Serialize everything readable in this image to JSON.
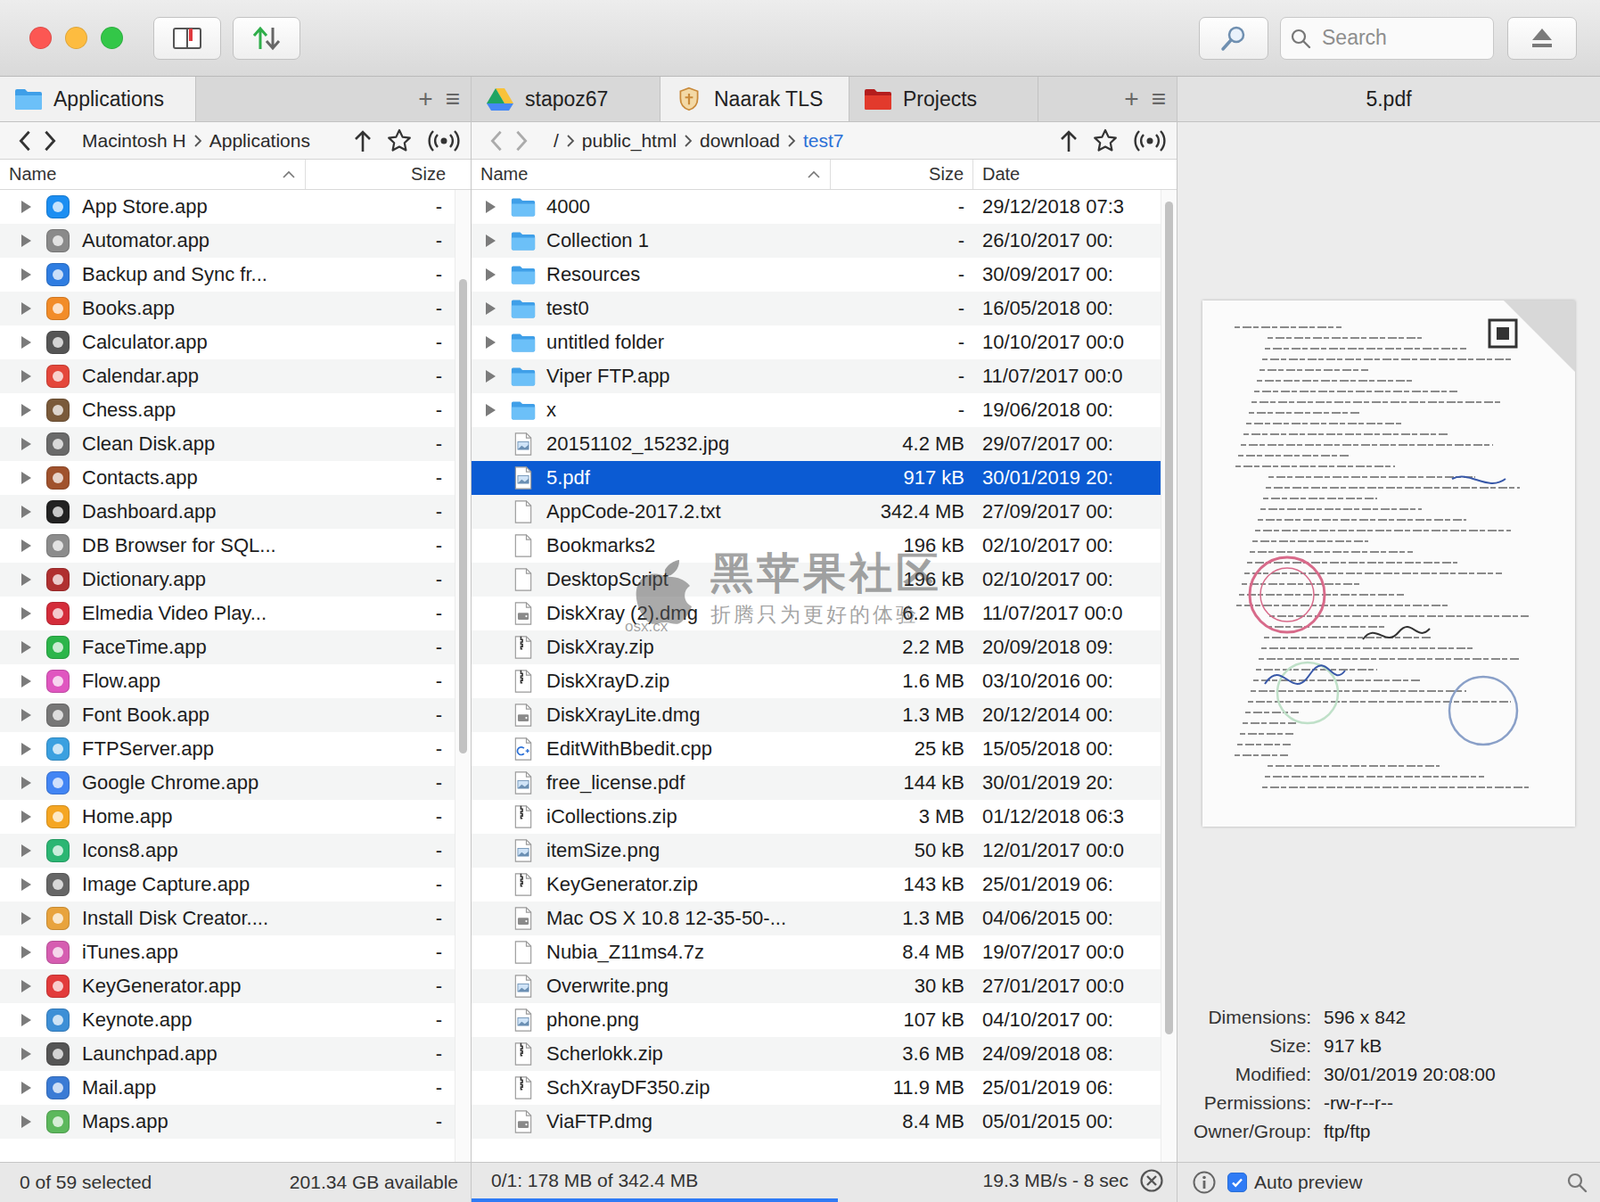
{
  "window": {
    "traffic_lights": [
      {
        "color": "#fc5753"
      },
      {
        "color": "#fdbc40"
      },
      {
        "color": "#33c748"
      }
    ]
  },
  "toolbar": {
    "search": {
      "placeholder": "Search"
    }
  },
  "left_panel": {
    "tabs": [
      {
        "label": "Applications",
        "selected": true
      }
    ],
    "tab_actions": [
      "+",
      "≡"
    ],
    "nav": {
      "back_disabled": false,
      "forward_disabled": false
    },
    "path": [
      {
        "label": "Macintosh H"
      },
      {
        "label": "Applications"
      }
    ],
    "columns": [
      {
        "label": "Name",
        "sort": "asc"
      },
      {
        "label": "Size",
        "sort": "none"
      }
    ],
    "scrollbar": {
      "offset": 0.09,
      "level": 0.49
    },
    "rows": [
      {
        "name": "App Store.app",
        "size": "-",
        "expanded": false,
        "color": "#1b8ef2"
      },
      {
        "name": "Automator.app",
        "size": "-",
        "expanded": false,
        "color": "#8a8a8a"
      },
      {
        "name": "Backup and Sync fr...",
        "size": "-",
        "expanded": false,
        "color": "#2f7de1"
      },
      {
        "name": "Books.app",
        "size": "-",
        "expanded": false,
        "color": "#f28c28"
      },
      {
        "name": "Calculator.app",
        "size": "-",
        "expanded": false,
        "color": "#555555"
      },
      {
        "name": "Calendar.app",
        "size": "-",
        "expanded": false,
        "color": "#e4473b"
      },
      {
        "name": "Chess.app",
        "size": "-",
        "expanded": false,
        "color": "#7a5a3a"
      },
      {
        "name": "Clean Disk.app",
        "size": "-",
        "expanded": false,
        "color": "#6a6a6a"
      },
      {
        "name": "Contacts.app",
        "size": "-",
        "expanded": false,
        "color": "#a0522d"
      },
      {
        "name": "Dashboard.app",
        "size": "-",
        "expanded": false,
        "color": "#222222"
      },
      {
        "name": "DB Browser for SQL...",
        "size": "-",
        "expanded": false,
        "color": "#8c8c8c"
      },
      {
        "name": "Dictionary.app",
        "size": "-",
        "expanded": false,
        "color": "#b03030"
      },
      {
        "name": "Elmedia Video Play...",
        "size": "-",
        "expanded": false,
        "color": "#d42c3a"
      },
      {
        "name": "FaceTime.app",
        "size": "-",
        "expanded": false,
        "color": "#2cb54a"
      },
      {
        "name": "Flow.app",
        "size": "-",
        "expanded": false,
        "color": "#e056c0"
      },
      {
        "name": "Font Book.app",
        "size": "-",
        "expanded": false,
        "color": "#777777"
      },
      {
        "name": "FTPServer.app",
        "size": "-",
        "expanded": false,
        "color": "#3aa0e0"
      },
      {
        "name": "Google Chrome.app",
        "size": "-",
        "expanded": false,
        "color": "#4285f4"
      },
      {
        "name": "Home.app",
        "size": "-",
        "expanded": false,
        "color": "#f5a623"
      },
      {
        "name": "Icons8.app",
        "size": "-",
        "expanded": false,
        "color": "#2bb673"
      },
      {
        "name": "Image Capture.app",
        "size": "-",
        "expanded": false,
        "color": "#666666"
      },
      {
        "name": "Install Disk Creator....",
        "size": "-",
        "expanded": false,
        "color": "#e8a33d"
      },
      {
        "name": "iTunes.app",
        "size": "-",
        "expanded": false,
        "color": "#d65db1"
      },
      {
        "name": "KeyGenerator.app",
        "size": "-",
        "expanded": false,
        "color": "#e23b3b"
      },
      {
        "name": "Keynote.app",
        "size": "-",
        "expanded": false,
        "color": "#3d8fd6"
      },
      {
        "name": "Launchpad.app",
        "size": "-",
        "expanded": false,
        "color": "#555555"
      },
      {
        "name": "Mail.app",
        "size": "-",
        "expanded": false,
        "color": "#3a7bd5"
      },
      {
        "name": "Maps.app",
        "size": "-",
        "expanded": false,
        "color": "#5cb85c"
      }
    ],
    "status": {
      "selection": "0 of 59 selected",
      "free": "201.34 GB available"
    }
  },
  "right_panel": {
    "tabs": [
      {
        "label": "stapoz67",
        "selected": false
      },
      {
        "label": "Naarak TLS",
        "selected": true
      },
      {
        "label": "Projects",
        "selected": false
      }
    ],
    "tab_actions": [
      "+",
      "≡"
    ],
    "nav": {
      "back_disabled": true,
      "forward_disabled": true
    },
    "path": [
      {
        "label": "/",
        "selected": false
      },
      {
        "label": "public_html",
        "selected": false
      },
      {
        "label": "download",
        "selected": false
      },
      {
        "label": "test7",
        "selected": true
      }
    ],
    "columns": [
      {
        "label": "Name",
        "sort": "asc"
      },
      {
        "label": "Size",
        "sort": "none"
      },
      {
        "label": "Date",
        "sort": "none"
      }
    ],
    "scrollbar": {
      "offset": 0.01,
      "level": 0.86
    },
    "rows": [
      {
        "name": "4000",
        "size": "-",
        "date": "29/12/2018 07:3",
        "kind": "folder",
        "expanded": false,
        "selected": false
      },
      {
        "name": "Collection 1",
        "size": "-",
        "date": "26/10/2017 00:",
        "kind": "folder",
        "expanded": false,
        "selected": false
      },
      {
        "name": "Resources",
        "size": "-",
        "date": "30/09/2017 00:",
        "kind": "folder",
        "expanded": false,
        "selected": false
      },
      {
        "name": "test0",
        "size": "-",
        "date": "16/05/2018 00:",
        "kind": "folder",
        "expanded": false,
        "selected": false
      },
      {
        "name": "untitled folder",
        "size": "-",
        "date": "10/10/2017 00:0",
        "kind": "folder",
        "expanded": false,
        "selected": false
      },
      {
        "name": "Viper FTP.app",
        "size": "-",
        "date": "11/07/2017 00:0",
        "kind": "folder",
        "expanded": false,
        "selected": false
      },
      {
        "name": "x",
        "size": "-",
        "date": "19/06/2018 00:",
        "kind": "folder",
        "expanded": false,
        "selected": false
      },
      {
        "name": "20151102_15232.jpg",
        "size": "4.2 MB",
        "date": "29/07/2017 00:",
        "kind": "image",
        "selected": false
      },
      {
        "name": "5.pdf",
        "size": "917 kB",
        "date": "30/01/2019 20:",
        "kind": "image",
        "selected": true
      },
      {
        "name": "AppCode-2017.2.txt",
        "size": "342.4 MB",
        "date": "27/09/2017 00:",
        "kind": "document",
        "selected": false
      },
      {
        "name": "Bookmarks2",
        "size": "196 kB",
        "date": "02/10/2017 00:",
        "kind": "document",
        "selected": false
      },
      {
        "name": "DesktopScript",
        "size": "196 kB",
        "date": "02/10/2017 00:",
        "kind": "document",
        "selected": false
      },
      {
        "name": "DiskXray (2).dmg",
        "size": "6.2 MB",
        "date": "11/07/2017 00:0",
        "kind": "disk",
        "selected": false
      },
      {
        "name": "DiskXray.zip",
        "size": "2.2 MB",
        "date": "20/09/2018 09:",
        "kind": "archive",
        "selected": false
      },
      {
        "name": "DiskXrayD.zip",
        "size": "1.6 MB",
        "date": "03/10/2016 00:",
        "kind": "archive",
        "selected": false
      },
      {
        "name": "DiskXrayLite.dmg",
        "size": "1.3 MB",
        "date": "20/12/2014 00:",
        "kind": "disk",
        "selected": false
      },
      {
        "name": "EditWithBbedit.cpp",
        "size": "25 kB",
        "date": "15/05/2018 00:",
        "kind": "code",
        "selected": false
      },
      {
        "name": "free_license.pdf",
        "size": "144 kB",
        "date": "30/01/2019 20:",
        "kind": "image",
        "selected": false
      },
      {
        "name": "iCollections.zip",
        "size": "3 MB",
        "date": "01/12/2018 06:3",
        "kind": "archive",
        "selected": false
      },
      {
        "name": "itemSize.png",
        "size": "50 kB",
        "date": "12/01/2017 00:0",
        "kind": "image",
        "selected": false
      },
      {
        "name": "KeyGenerator.zip",
        "size": "143 kB",
        "date": "25/01/2019 06:",
        "kind": "archive",
        "selected": false
      },
      {
        "name": "Mac OS X 10.8 12-35-50-...",
        "size": "1.3 MB",
        "date": "04/06/2015 00:",
        "kind": "disk",
        "selected": false
      },
      {
        "name": "Nubia_Z11ms4.7z",
        "size": "8.4 MB",
        "date": "19/07/2017 00:0",
        "kind": "document",
        "selected": false
      },
      {
        "name": "Overwrite.png",
        "size": "30 kB",
        "date": "27/01/2017 00:0",
        "kind": "image",
        "selected": false
      },
      {
        "name": "phone.png",
        "size": "107 kB",
        "date": "04/10/2017 00:",
        "kind": "image",
        "selected": false
      },
      {
        "name": "Scherlokk.zip",
        "size": "3.6 MB",
        "date": "24/09/2018 08:",
        "kind": "archive",
        "selected": false
      },
      {
        "name": "SchXrayDF350.zip",
        "size": "11.9 MB",
        "date": "25/01/2019 06:",
        "kind": "archive",
        "selected": false
      },
      {
        "name": "ViaFTP.dmg",
        "size": "8.4 MB",
        "date": "05/01/2015 00:",
        "kind": "disk",
        "selected": false
      }
    ],
    "status": {
      "transfer": "0/1: 178 MB of 342.4 MB",
      "level": 0.52,
      "speed": "19.3 MB/s - 8 sec"
    }
  },
  "watermark": {
    "title": "黑苹果社区",
    "site": "osx.cx",
    "slogan": "折腾只为更好的体验"
  },
  "preview": {
    "title": "5.pdf",
    "info": [
      {
        "label": "Dimensions:",
        "value": "596 x 842"
      },
      {
        "label": "Size:",
        "value": "917 kB"
      },
      {
        "label": "Modified:",
        "value": "30/01/2019 20:08:00"
      },
      {
        "label": "Permissions:",
        "value": "-rw-r--r--"
      },
      {
        "label": "Owner/Group:",
        "value": "ftp/ftp"
      }
    ],
    "auto_preview": {
      "label": "Auto preview",
      "checked": true
    }
  }
}
